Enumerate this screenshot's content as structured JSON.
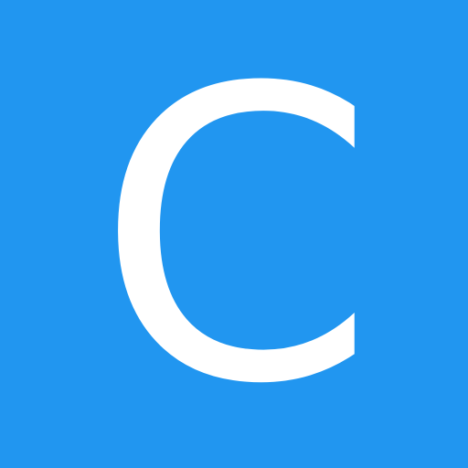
{
  "avatar": {
    "letter": "C",
    "background_color": "#2196f0",
    "letter_color": "#ffffff"
  }
}
